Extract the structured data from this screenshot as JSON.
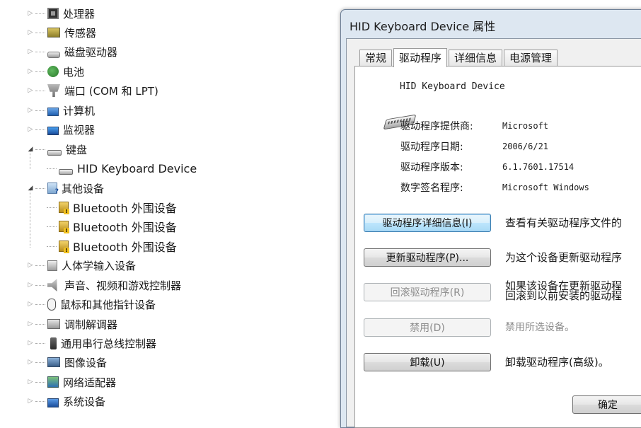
{
  "tree": {
    "items": [
      {
        "label": "处理器",
        "icon": "processor-icon",
        "expanded": false
      },
      {
        "label": "传感器",
        "icon": "sensor-icon",
        "expanded": false
      },
      {
        "label": "磁盘驱动器",
        "icon": "disk-drive-icon",
        "expanded": false
      },
      {
        "label": "电池",
        "icon": "battery-icon",
        "expanded": false
      },
      {
        "label": "端口 (COM 和 LPT)",
        "icon": "port-icon",
        "expanded": false
      },
      {
        "label": "计算机",
        "icon": "computer-icon",
        "expanded": false
      },
      {
        "label": "监视器",
        "icon": "monitor-icon",
        "expanded": false
      },
      {
        "label": "键盘",
        "icon": "keyboard-icon",
        "expanded": true
      },
      {
        "label": "HID Keyboard Device",
        "icon": "keyboard-icon",
        "child": true
      },
      {
        "label": "其他设备",
        "icon": "other-devices-icon",
        "expanded": true
      },
      {
        "label": "Bluetooth 外围设备",
        "icon": "bluetooth-warning-icon",
        "child": true
      },
      {
        "label": "Bluetooth 外围设备",
        "icon": "bluetooth-warning-icon",
        "child": true
      },
      {
        "label": "Bluetooth 外围设备",
        "icon": "bluetooth-warning-icon",
        "child": true
      },
      {
        "label": "人体学输入设备",
        "icon": "hid-icon",
        "expanded": false
      },
      {
        "label": "声音、视频和游戏控制器",
        "icon": "sound-icon",
        "expanded": false
      },
      {
        "label": "鼠标和其他指针设备",
        "icon": "mouse-icon",
        "expanded": false
      },
      {
        "label": "调制解调器",
        "icon": "modem-icon",
        "expanded": false
      },
      {
        "label": "通用串行总线控制器",
        "icon": "usb-icon",
        "expanded": false
      },
      {
        "label": "图像设备",
        "icon": "imaging-icon",
        "expanded": false
      },
      {
        "label": "网络适配器",
        "icon": "network-icon",
        "expanded": false
      },
      {
        "label": "系统设备",
        "icon": "system-icon",
        "expanded": false
      }
    ]
  },
  "dialog": {
    "title": "HID Keyboard Device 属性",
    "tabs": [
      "常规",
      "驱动程序",
      "详细信息",
      "电源管理"
    ],
    "active_tab": "驱动程序",
    "device_name": "HID Keyboard Device",
    "props": [
      {
        "label": "驱动程序提供商:",
        "value": "Microsoft"
      },
      {
        "label": "驱动程序日期:",
        "value": "2006/6/21"
      },
      {
        "label": "驱动程序版本:",
        "value": "6.1.7601.17514"
      },
      {
        "label": "数字签名程序:",
        "value": "Microsoft Windows"
      }
    ],
    "actions": [
      {
        "button": "驱动程序详细信息(I)",
        "desc": "查看有关驱动程序文件的",
        "state": "focused"
      },
      {
        "button": "更新驱动程序(P)...",
        "desc": "为这个设备更新驱动程序",
        "state": "normal"
      },
      {
        "button": "回滚驱动程序(R)",
        "desc": "如果该设备在更新驱动程\n回滚到以前安装的驱动程",
        "state": "disabled"
      },
      {
        "button": "禁用(D)",
        "desc": "禁用所选设备。",
        "state": "disabled"
      },
      {
        "button": "卸载(U)",
        "desc": "卸载驱动程序(高级)。",
        "state": "normal"
      }
    ],
    "ok_label": "确定"
  }
}
